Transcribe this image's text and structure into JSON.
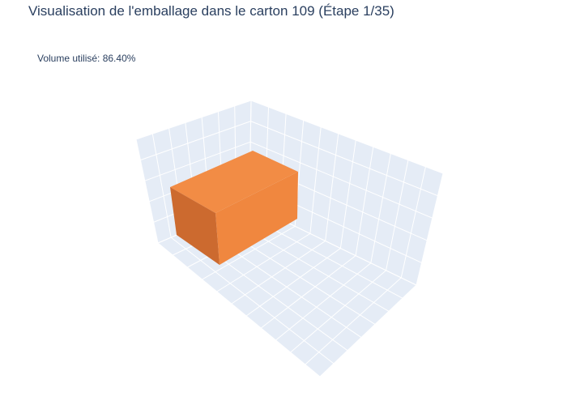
{
  "chart_data": {
    "type": "3d-box-packing",
    "title": "Visualisation de l'emballage dans le carton 109 (Étape 1/35)",
    "annotation": "Volume utilisé: 86.40%",
    "volume_used_percent": 86.4,
    "step": {
      "current": 1,
      "total": 35
    },
    "carton_id": 109,
    "grid": true,
    "colors": {
      "scene_pane": "#e5ecf6",
      "grid_line": "#ffffff",
      "box_front": "#f0873f",
      "box_top": "#f28c45",
      "box_side": "#cc6a2f",
      "text": "#2a3f5f"
    }
  }
}
